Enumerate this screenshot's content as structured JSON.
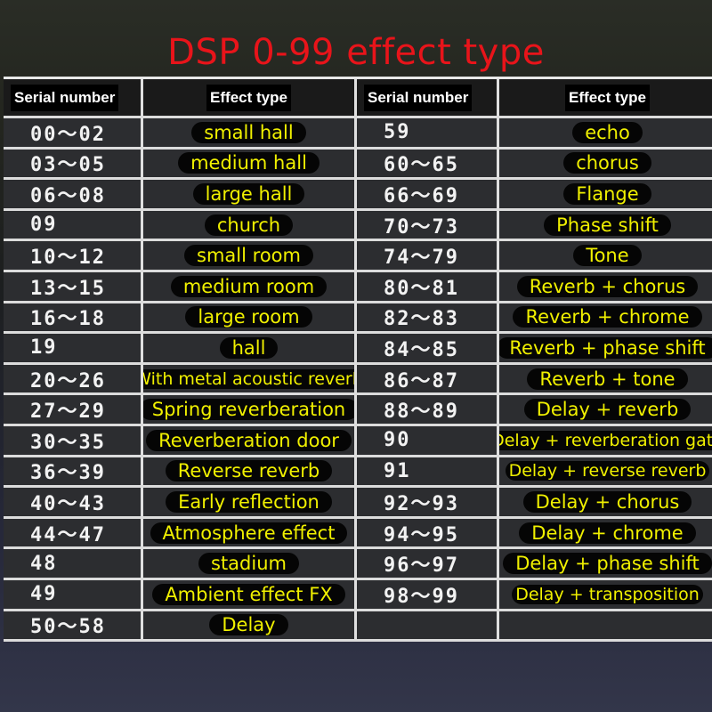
{
  "title": "DSP 0-99 effect type",
  "headers": {
    "left_serial": "Serial number",
    "left_effect": "Effect type",
    "right_serial": "Serial number",
    "right_effect": "Effect type"
  },
  "colors": {
    "title": "#e8141a",
    "effect_text": "#f0f000",
    "serial_text": "#f2f2f2"
  },
  "rows": [
    {
      "ls": "00～02",
      "le": "small hall",
      "rs": "59",
      "re": "echo"
    },
    {
      "ls": "03～05",
      "le": "medium hall",
      "rs": "60～65",
      "re": "chorus"
    },
    {
      "ls": "06～08",
      "le": "large hall",
      "rs": "66～69",
      "re": "Flange"
    },
    {
      "ls": "09",
      "le": "church",
      "rs": "70～73",
      "re": "Phase shift"
    },
    {
      "ls": "10～12",
      "le": "small room",
      "rs": "74～79",
      "re": "Tone"
    },
    {
      "ls": "13～15",
      "le": "medium room",
      "rs": "80～81",
      "re": "Reverb + chorus"
    },
    {
      "ls": "16～18",
      "le": "large room",
      "rs": "82～83",
      "re": "Reverb + chrome"
    },
    {
      "ls": "19",
      "le": "hall",
      "rs": "84～85",
      "re": "Reverb + phase shift"
    },
    {
      "ls": "20～26",
      "le": "With metal acoustic reverb",
      "rs": "86～87",
      "re": "Reverb + tone"
    },
    {
      "ls": "27～29",
      "le": "Spring reverberation",
      "rs": "88～89",
      "re": "Delay + reverb"
    },
    {
      "ls": "30～35",
      "le": "Reverberation door",
      "rs": "90",
      "re": "Delay + reverberation gate"
    },
    {
      "ls": "36～39",
      "le": "Reverse reverb",
      "rs": "91",
      "re": "Delay + reverse reverb"
    },
    {
      "ls": "40～43",
      "le": "Early reflection",
      "rs": "92～93",
      "re": "Delay + chorus"
    },
    {
      "ls": "44～47",
      "le": "Atmosphere effect",
      "rs": "94～95",
      "re": "Delay + chrome"
    },
    {
      "ls": "48",
      "le": "stadium",
      "rs": "96～97",
      "re": "Delay + phase shift"
    },
    {
      "ls": "49",
      "le": "Ambient effect FX",
      "rs": "98～99",
      "re": "Delay + transposition"
    },
    {
      "ls": "50～58",
      "le": "Delay",
      "rs": "",
      "re": ""
    }
  ]
}
